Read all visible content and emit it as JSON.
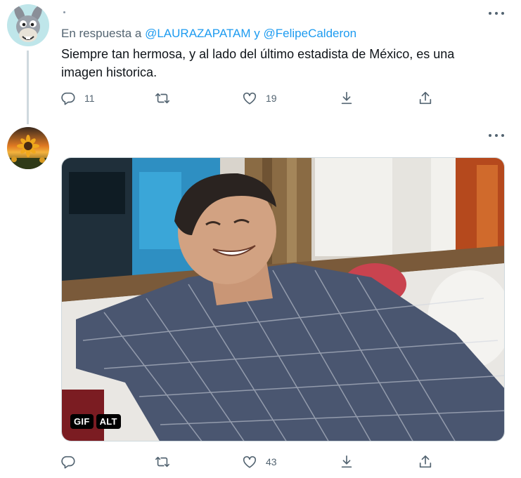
{
  "tweets": [
    {
      "reply_prefix": "En respuesta a",
      "mention1": "@LAURAZAPATAM",
      "conjunction": "y",
      "mention2": "@FelipeCalderon",
      "text": "Siempre tan hermosa, y al lado del último estadista de México, es una imagen historica.",
      "reply_count": "11",
      "retweet_count": "",
      "like_count": "19",
      "avatar_icon": "cartoon-donkey-avatar"
    },
    {
      "reply_count": "",
      "retweet_count": "",
      "like_count": "43",
      "avatar_icon": "sunflower-sunset-avatar",
      "media": {
        "gif_badge": "GIF",
        "alt_badge": "ALT"
      }
    }
  ],
  "colors": {
    "link": "#1d9bf0",
    "muted": "#536471",
    "text": "#0f1419",
    "divider": "#cfd9de"
  },
  "icons": [
    "reply-icon",
    "retweet-icon",
    "like-icon",
    "download-icon",
    "share-icon",
    "more-icon"
  ]
}
